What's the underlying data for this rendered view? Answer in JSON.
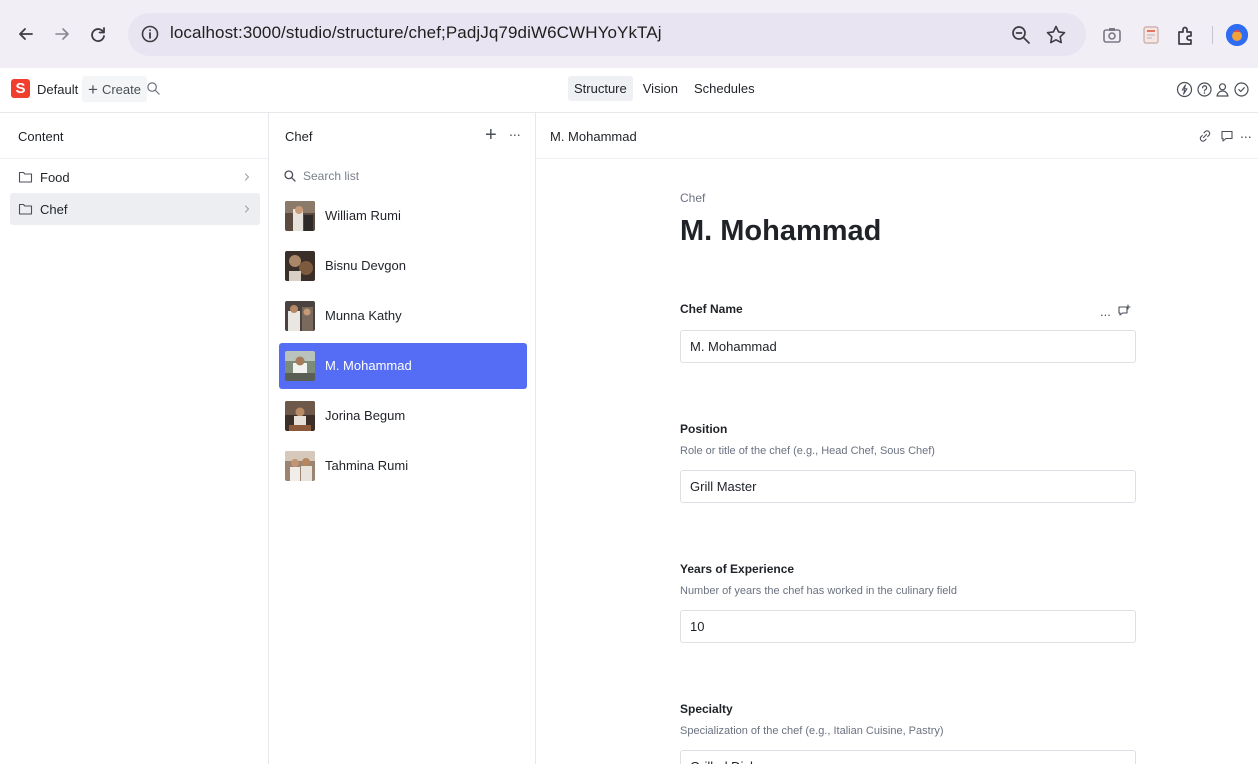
{
  "browser": {
    "url": "localhost:3000/studio/structure/chef;PadjJq79diW6CWHYoYkTAj"
  },
  "studio": {
    "logo_letter": "S",
    "workspace": "Default",
    "create_label": "Create",
    "tools": [
      "Structure",
      "Vision",
      "Schedules"
    ],
    "active_tool": "Structure"
  },
  "content_pane": {
    "title": "Content",
    "items": [
      {
        "label": "Food"
      },
      {
        "label": "Chef"
      }
    ],
    "selected": "Chef"
  },
  "list_pane": {
    "title": "Chef",
    "search_placeholder": "Search list",
    "more_icon": "...",
    "items": [
      {
        "name": "William Rumi"
      },
      {
        "name": "Bisnu Devgon"
      },
      {
        "name": "Munna Kathy"
      },
      {
        "name": "M. Mohammad"
      },
      {
        "name": "Jorina Begum"
      },
      {
        "name": "Tahmina Rumi"
      }
    ],
    "selected": "M. Mohammad"
  },
  "document": {
    "header_title": "M. Mohammad",
    "type_label": "Chef",
    "heading": "M. Mohammad",
    "fields": [
      {
        "label": "Chef Name",
        "description": "",
        "value": "M. Mohammad"
      },
      {
        "label": "Position",
        "description": "Role or title of the chef (e.g., Head Chef, Sous Chef)",
        "value": "Grill Master"
      },
      {
        "label": "Years of Experience",
        "description": "Number of years the chef has worked in the culinary field",
        "value": "10"
      },
      {
        "label": "Specialty",
        "description": "Specialization of the chef (e.g., Italian Cuisine, Pastry)",
        "value": "Grilled Dishes"
      }
    ]
  },
  "colors": {
    "accent": "#556cf5",
    "brand": "#f03e2f",
    "browser_bar": "#f1eef6"
  }
}
